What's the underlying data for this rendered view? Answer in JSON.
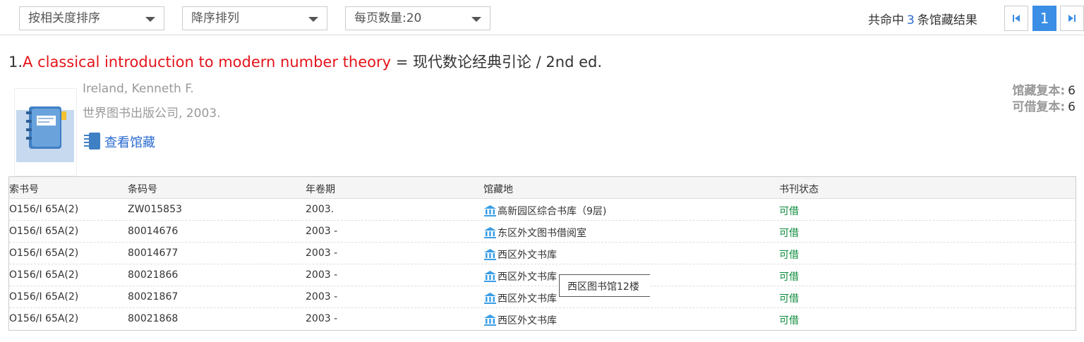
{
  "toolbar": {
    "sort_by": "按相关度排序",
    "sort_order": "降序排列",
    "page_size": "每页数量:20"
  },
  "results": {
    "prefix": "共命中",
    "count": "3",
    "suffix": "条馆藏结果"
  },
  "pagination": {
    "current": "1"
  },
  "record": {
    "index": "1.",
    "title_link": "A classical introduction to modern number theory",
    "title_rest": " = 现代数论经典引论 / 2nd ed.",
    "author": "Ireland, Kenneth F.",
    "publisher": "世界图书出版公司, 2003.",
    "view_holdings": "查看馆藏",
    "copies_label": "馆藏复本:",
    "copies_value": "6",
    "loanable_label": "可借复本:",
    "loanable_value": "6"
  },
  "holdings": {
    "headers": [
      "索书号",
      "条码号",
      "年卷期",
      "馆藏地",
      "书刊状态"
    ],
    "rows": [
      {
        "call_no": "O156/I 65A(2)",
        "barcode": "ZW015853",
        "volume": "2003.",
        "location": "高新园区综合书库（9层)",
        "status": "可借"
      },
      {
        "call_no": "O156/I 65A(2)",
        "barcode": "80014676",
        "volume": "2003 -",
        "location": "东区外文图书借阅室",
        "status": "可借"
      },
      {
        "call_no": "O156/I 65A(2)",
        "barcode": "80014677",
        "volume": "2003 -",
        "location": "西区外文书库",
        "status": "可借"
      },
      {
        "call_no": "O156/I 65A(2)",
        "barcode": "80021866",
        "volume": "2003 -",
        "location": "西区外文书库",
        "status": "可借"
      },
      {
        "call_no": "O156/I 65A(2)",
        "barcode": "80021867",
        "volume": "2003 -",
        "location": "西区外文书库",
        "status": "可借"
      },
      {
        "call_no": "O156/I 65A(2)",
        "barcode": "80021868",
        "volume": "2003 -",
        "location": "西区外文书库",
        "status": "可借"
      }
    ]
  },
  "tooltip": {
    "text": "西区图书馆12楼"
  },
  "colors": {
    "accent": "#3a8ee6",
    "title_red": "#e4141b",
    "status_green": "#0a8a3a",
    "link_blue": "#2a6bd1"
  }
}
